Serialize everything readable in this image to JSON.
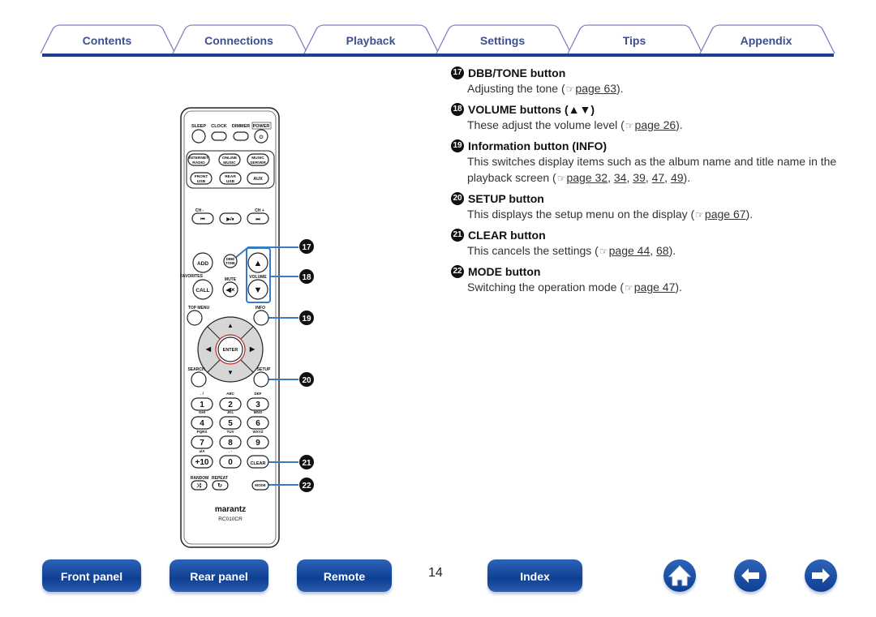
{
  "tabs": [
    "Contents",
    "Connections",
    "Playback",
    "Settings",
    "Tips",
    "Appendix"
  ],
  "remote": {
    "top_labels": [
      "SLEEP",
      "CLOCK",
      "DIMMER",
      "POWER"
    ],
    "sources": [
      [
        "INTERNET",
        "RADIO"
      ],
      [
        "ONLINE",
        "MUSIC"
      ],
      [
        "MUSIC",
        "SERVER"
      ],
      [
        "FRONT",
        "USB"
      ],
      [
        "REAR",
        "USB"
      ],
      [
        "AUX"
      ]
    ],
    "ch_minus": "CH -",
    "ch_plus": "CH +",
    "transport": [
      "⏮",
      "▶/⏸",
      "⏭"
    ],
    "add": "ADD",
    "dbb": [
      "DBB/",
      "TONE"
    ],
    "favorites": "FAVORITES",
    "mute": "MUTE",
    "volume": "VOLUME",
    "call": "CALL",
    "top_menu": "TOP MENU",
    "info": "INFO",
    "enter": "ENTER",
    "search": "SEARCH",
    "setup": "SETUP",
    "keys": [
      {
        "sub": ". /",
        "key": "1"
      },
      {
        "sub": "ABC",
        "key": "2"
      },
      {
        "sub": "DEF",
        "key": "3"
      },
      {
        "sub": "GHI",
        "key": "4"
      },
      {
        "sub": "JKL",
        "key": "5"
      },
      {
        "sub": "MNO",
        "key": "6"
      },
      {
        "sub": "PQRS",
        "key": "7"
      },
      {
        "sub": "TUV",
        "key": "8"
      },
      {
        "sub": "WXYZ",
        "key": "9"
      },
      {
        "sub": "a/A",
        "key": "+10"
      },
      {
        "sub": ". -",
        "key": "0"
      },
      {
        "sub": "",
        "key": "CLEAR"
      }
    ],
    "random": "RANDOM",
    "repeat": "REPEAT",
    "mode": "MODE",
    "brand": "marantz",
    "model": "RC010CR",
    "callouts": [
      "17",
      "18",
      "19",
      "20",
      "21",
      "22"
    ]
  },
  "items": [
    {
      "num": "17",
      "title": "DBB/TONE button",
      "pre": "Adjusting the tone (",
      "links": [
        "page 63"
      ],
      "post": ")."
    },
    {
      "num": "18",
      "title": "VOLUME buttons (▲▼)",
      "pre": "These adjust the volume level (",
      "links": [
        "page 26"
      ],
      "post": ")."
    },
    {
      "num": "19",
      "title": "Information button (INFO)",
      "pre": "This switches display items such as the album name and title name in the playback screen (",
      "links": [
        "page 32",
        "34",
        "39",
        "47",
        "49"
      ],
      "post": ")."
    },
    {
      "num": "20",
      "title": "SETUP button",
      "pre": "This displays the setup menu on the display (",
      "links": [
        "page 67"
      ],
      "post": ")."
    },
    {
      "num": "21",
      "title": "CLEAR button",
      "pre": "This cancels the settings (",
      "links": [
        "page 44",
        "68"
      ],
      "post": ")."
    },
    {
      "num": "22",
      "title": "MODE button",
      "pre": "Switching the operation mode (",
      "links": [
        "page 47"
      ],
      "post": ")."
    }
  ],
  "footer": {
    "front_panel": "Front panel",
    "rear_panel": "Rear panel",
    "remote": "Remote",
    "page_number": "14",
    "index": "Index"
  },
  "colors": {
    "accent": "#1c3f8f",
    "callout": "#3a7cc2",
    "tab_text": "#3d4f8f"
  }
}
